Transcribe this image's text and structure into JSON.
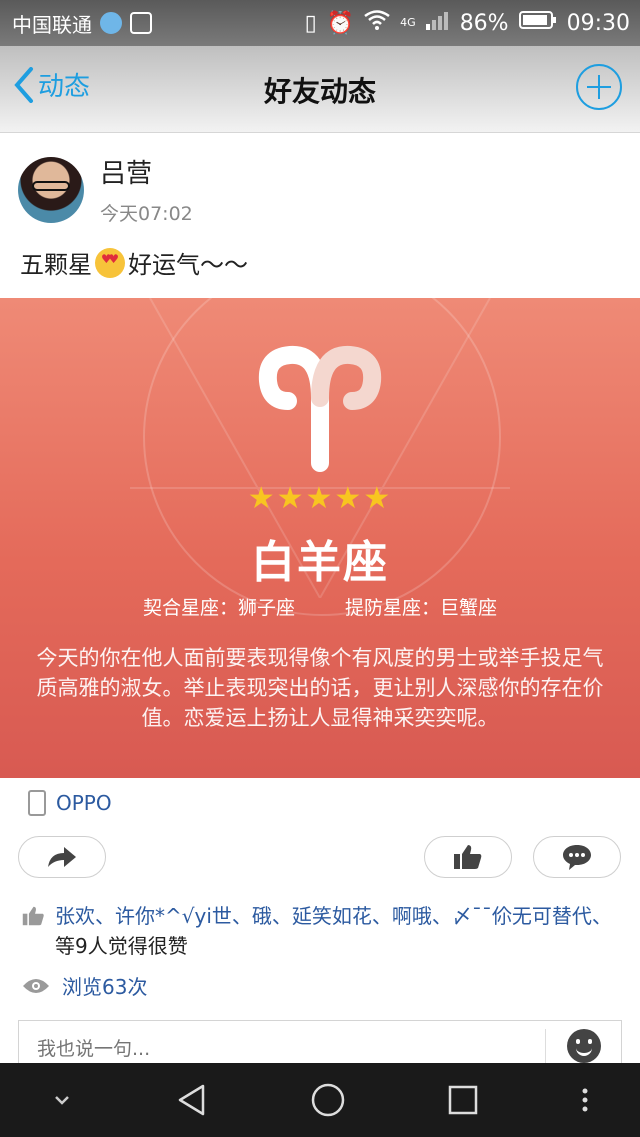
{
  "status_bar": {
    "carrier": "中国联通",
    "network": "4G",
    "battery": "86%",
    "time": "09:30"
  },
  "nav": {
    "back_label": "动态",
    "title": "好友动态"
  },
  "post": {
    "username": "吕营",
    "time": "今天07:02",
    "text_before": "五颗星",
    "text_after": "好运气～～",
    "image": {
      "stars": "★★★★★",
      "sign": "白羊座",
      "match": "契合星座：狮子座",
      "beware": "提防星座：巨蟹座",
      "description": "今天的你在他人面前要表现得像个有风度的男士或举手投足气质高雅的淑女。举止表现突出的话，更让别人深感你的存在价值。恋爱运上扬让人显得神采奕奕呢。"
    },
    "device": "OPPO",
    "likes_names": "张欢、许你*^√yi世、硪、延笑如花、啊哦、〆ˉˉ伱无可替代、",
    "likes_tail": "等9人觉得很赞",
    "views": "浏览63次",
    "comment_placeholder": "我也说一句..."
  },
  "colors": {
    "accent": "#1e9ee0",
    "link": "#2c5aa0",
    "star": "#f8c520",
    "image_bg": "#e46a5a"
  }
}
